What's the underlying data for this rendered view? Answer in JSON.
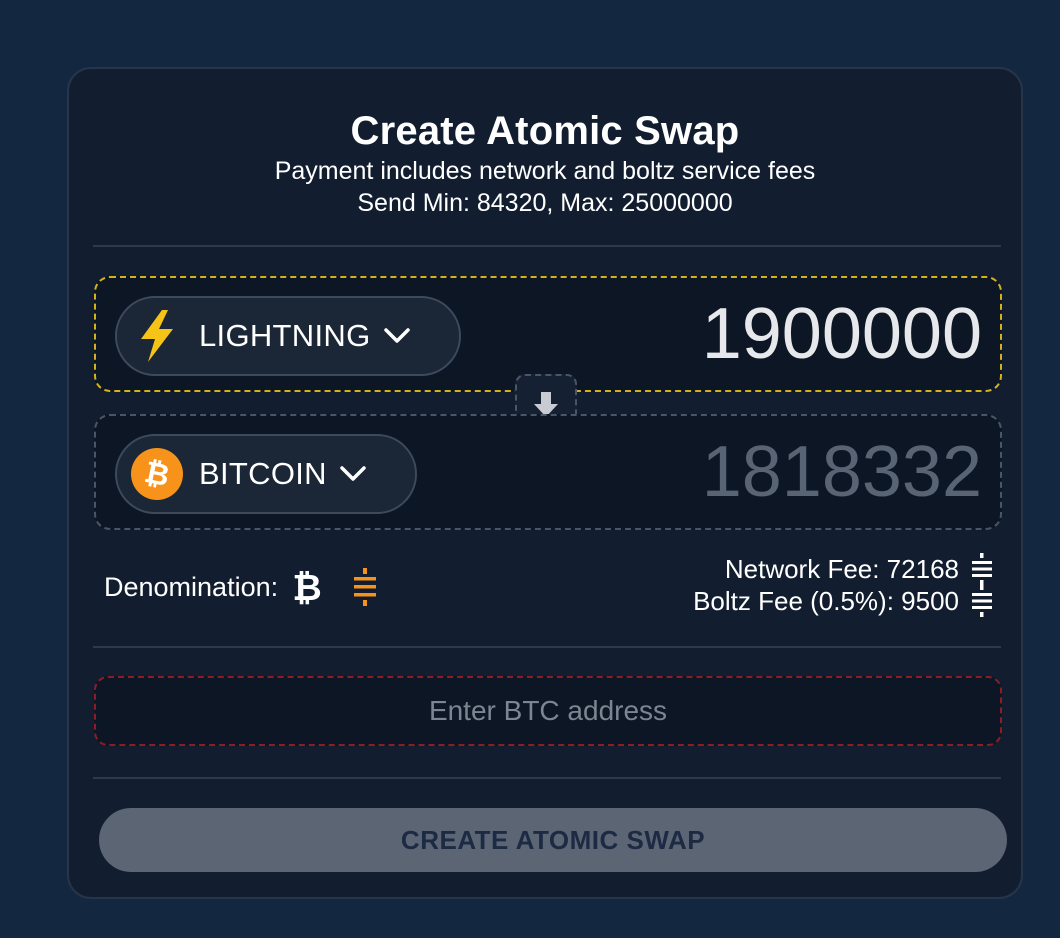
{
  "header": {
    "title": "Create Atomic Swap",
    "subtitle": "Payment includes network and boltz service fees",
    "limits": "Send Min: 84320, Max: 25000000"
  },
  "send": {
    "asset_label": "LIGHTNING",
    "asset_icon": "lightning-bolt-icon",
    "amount": "1900000",
    "accent_color": "#d4b21e"
  },
  "receive": {
    "asset_label": "BITCOIN",
    "asset_icon": "bitcoin-logo-icon",
    "amount": "1818332",
    "accent_color": "#f7931a"
  },
  "denomination": {
    "label": "Denomination:",
    "options": [
      "btc-icon",
      "sats-icon"
    ],
    "selected": "sats-icon"
  },
  "fees": {
    "network": "Network Fee: 72168",
    "boltz": "Boltz Fee (0.5%): 9500"
  },
  "address": {
    "placeholder": "Enter BTC address",
    "value": ""
  },
  "create_button": {
    "label": "CREATE ATOMIC SWAP"
  }
}
